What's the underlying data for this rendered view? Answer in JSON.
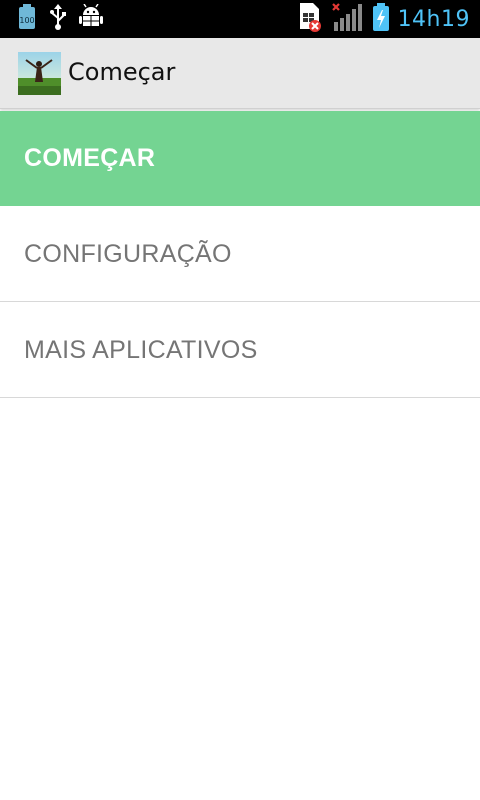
{
  "status_bar": {
    "battery_level_label": "100",
    "time": "14h19"
  },
  "action_bar": {
    "title": "Começar"
  },
  "menu": {
    "items": [
      {
        "label": "COMEÇAR",
        "active": true
      },
      {
        "label": "CONFIGURAÇÃO",
        "active": false
      },
      {
        "label": "MAIS APLICATIVOS",
        "active": false
      }
    ]
  },
  "colors": {
    "active_item": "#74d492",
    "inactive_text": "#757575",
    "clock": "#4fc3f7"
  },
  "icons": [
    "battery-100-icon",
    "usb-icon",
    "android-debug-icon",
    "sim-error-icon",
    "no-signal-icon",
    "battery-charging-icon"
  ]
}
